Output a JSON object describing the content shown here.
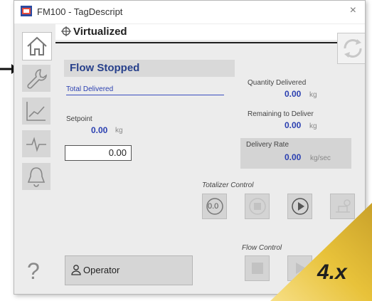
{
  "window": {
    "title": "FM100 - TagDescript",
    "close_glyph": "×"
  },
  "header": {
    "mode": "Virtualized"
  },
  "status": {
    "banner": "Flow Stopped"
  },
  "totals": {
    "label": "Total Delivered"
  },
  "setpoint": {
    "label": "Setpoint",
    "value": "0.00",
    "unit": "kg",
    "input_value": "0.00"
  },
  "quantity_delivered": {
    "label": "Quantity Delivered",
    "value": "0.00",
    "unit": "kg"
  },
  "remaining": {
    "label": "Remaining to Deliver",
    "value": "0.00",
    "unit": "kg"
  },
  "delivery_rate": {
    "label": "Delivery Rate",
    "value": "0.00",
    "unit": "kg/sec"
  },
  "totalizer_control": {
    "label": "Totalizer Control",
    "reset_label": "0.0"
  },
  "flow_control": {
    "label": "Flow Control"
  },
  "operator": {
    "label": "Operator"
  },
  "help": {
    "glyph": "?"
  },
  "badge": {
    "version": "4.x"
  },
  "colors": {
    "accent_blue": "#2a3fb0",
    "badge_gold": "#e8c23a"
  },
  "icons": [
    "home-icon",
    "wrench-icon",
    "trend-icon",
    "pulse-icon",
    "bell-icon",
    "sync-icon"
  ]
}
